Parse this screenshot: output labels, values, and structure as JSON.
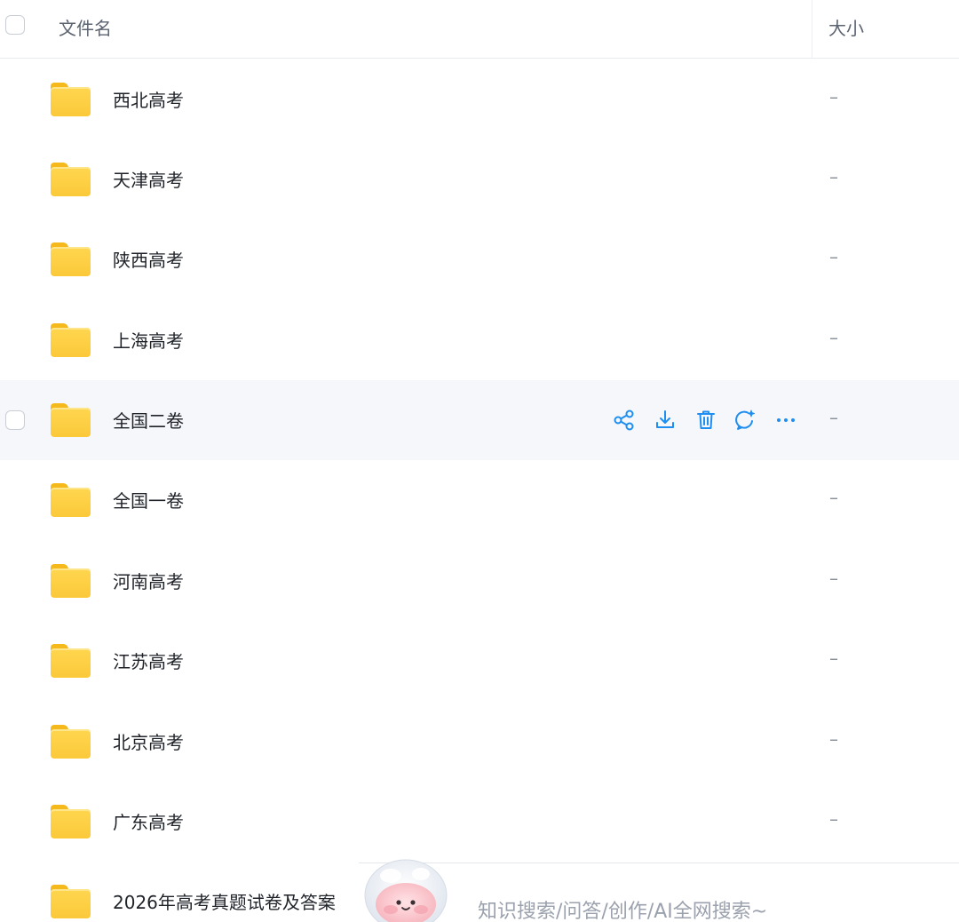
{
  "header": {
    "name_label": "文件名",
    "size_label": "大小"
  },
  "rows": [
    {
      "name": "西北高考",
      "size": "–"
    },
    {
      "name": "天津高考",
      "size": "–"
    },
    {
      "name": "陕西高考",
      "size": "–"
    },
    {
      "name": "上海高考",
      "size": "–"
    },
    {
      "name": "全国二卷",
      "size": "–"
    },
    {
      "name": "全国一卷",
      "size": "–"
    },
    {
      "name": "河南高考",
      "size": "–"
    },
    {
      "name": "江苏高考",
      "size": "–"
    },
    {
      "name": "北京高考",
      "size": "–"
    },
    {
      "name": "广东高考",
      "size": "–"
    },
    {
      "name": "2026年高考真题试卷及答案",
      "size": ""
    }
  ],
  "hover_actions": [
    "share-icon",
    "download-icon",
    "trash-icon",
    "ai-chat-icon",
    "more-icon"
  ],
  "search": {
    "placeholder": "知识搜索/问答/创作/AI全网搜索~"
  },
  "colors": {
    "accent": "#1e8ef0",
    "folder": "#fbc93a",
    "hover_row": "#f5f7fb"
  }
}
